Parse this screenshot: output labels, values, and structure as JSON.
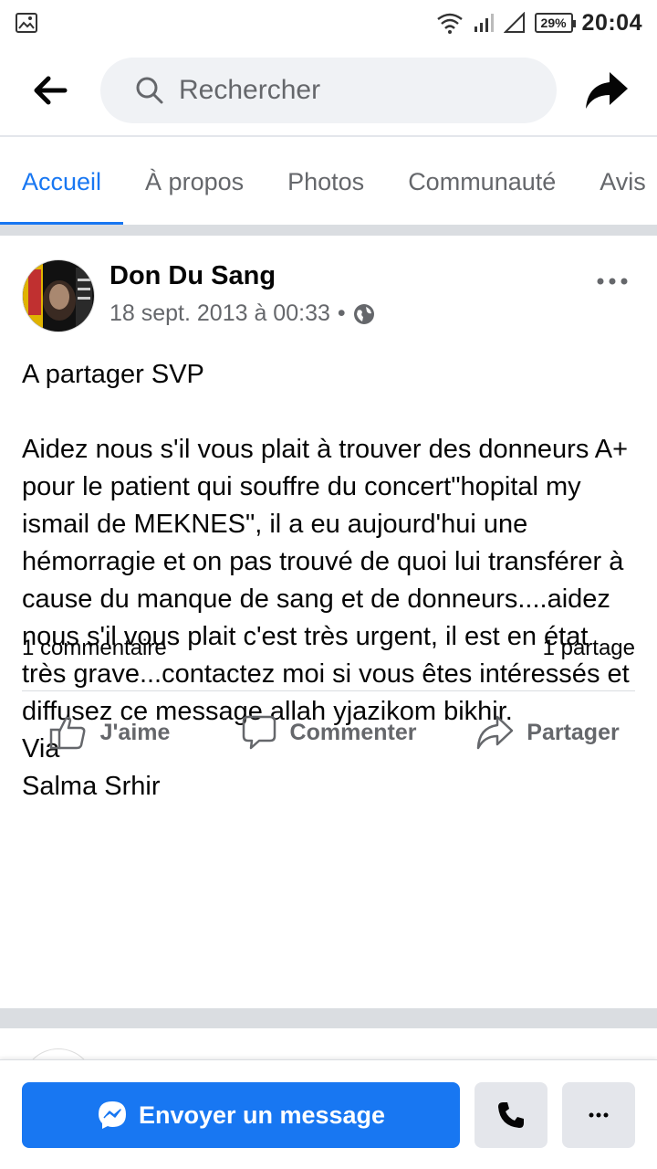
{
  "status_bar": {
    "time": "20:04",
    "battery": "29%"
  },
  "top_bar": {
    "search_placeholder": "Rechercher"
  },
  "tabs": [
    {
      "label": "Accueil",
      "active": true
    },
    {
      "label": "À propos",
      "active": false
    },
    {
      "label": "Photos",
      "active": false
    },
    {
      "label": "Communauté",
      "active": false
    },
    {
      "label": "Avis",
      "active": false
    }
  ],
  "post": {
    "author": "Don Du Sang",
    "timestamp": "18 sept. 2013 à 00:33",
    "separator": "•",
    "text": "A partager SVP\n\nAidez nous s'il vous plait à trouver des donneurs A+ pour le patient qui souffre du concert\"hopital my ismail de MEKNES\", il a eu aujourd'hui une hémorragie et on pas trouvé de quoi lui transférer à cause du manque de sang et de donneurs....aidez nous s'il vous plait c'est très urgent, il est en état très grave...contactez moi si vous êtes intéressés et diffusez ce message allah yjazikom bikhir.\nVia\nSalma Srhir",
    "comments_count": "1 commentaire",
    "shares_count": "1 partage",
    "actions": {
      "like": "J'aime",
      "comment": "Commenter",
      "share": "Partager"
    }
  },
  "bottom_bar": {
    "message_button": "Envoyer un message"
  },
  "colors": {
    "accent": "#1877f2",
    "muted": "#65676b",
    "divider": "#dadde1"
  }
}
